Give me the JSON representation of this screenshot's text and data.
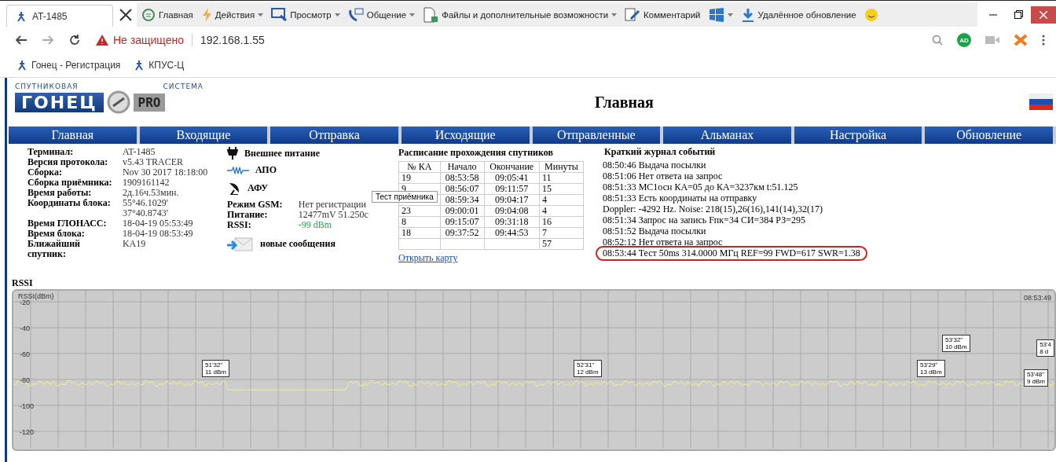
{
  "browser": {
    "tab_title": "AT-1485",
    "toolbar": [
      {
        "kind": "home",
        "label": "Главная",
        "dropdown": false
      },
      {
        "kind": "bolt",
        "label": "Действия",
        "dropdown": true
      },
      {
        "kind": "monitor",
        "label": "Просмотр",
        "dropdown": true
      },
      {
        "kind": "chat",
        "label": "Общение",
        "dropdown": true
      },
      {
        "kind": "files",
        "label": "Файлы и дополнительные возможности",
        "dropdown": true
      },
      {
        "kind": "note",
        "label": "Комментарий",
        "dropdown": false
      },
      {
        "kind": "windows",
        "dropdown": true
      },
      {
        "kind": "download",
        "label": "Удалённое обновление",
        "dropdown": false
      }
    ],
    "address": {
      "security": "Не защищено",
      "url": "192.168.1.55"
    },
    "extension_badge": "AD",
    "bookmarks": [
      "Гонец - Регистрация",
      "КПУС-Ц"
    ]
  },
  "page": {
    "logo": {
      "top_left": "СПУТНИКОВАЯ",
      "top_right": "СИСТЕМА",
      "name": "ГОНЕЦ",
      "suffix": "PRO"
    },
    "title": "Главная",
    "nav": [
      "Главная",
      "Входящие",
      "Отправка",
      "Исходящие",
      "Отправленные",
      "Альманах",
      "Настройка",
      "Обновление"
    ],
    "terminal": [
      {
        "label": "Терминал:",
        "value": "AT-1485"
      },
      {
        "label": "Версия протокола:",
        "value": "v5.43 TRACER"
      },
      {
        "label": "Сборка:",
        "value": "Nov 30 2017 18:18:00"
      },
      {
        "label": "Сборка приёмника:",
        "value": "1909161142"
      },
      {
        "label": "Время работы:",
        "value": "2д.16ч.53мин."
      },
      {
        "label": "Координаты блока:",
        "value": "55°46.1029' 37°40.8743'"
      },
      {
        "label": "Время ГЛОНАСС:",
        "value": "18-04-19 05:53:49"
      },
      {
        "label": "Время блока:",
        "value": "18-04-19 08:53:49"
      },
      {
        "label": "Ближайший спутник:",
        "value": "KA19"
      }
    ],
    "status": [
      {
        "kind": "plug",
        "label": "Внешнее питание"
      },
      {
        "kind": "wave",
        "label": "АПО"
      },
      {
        "kind": "dish",
        "label": "АФУ"
      }
    ],
    "gsm": [
      {
        "label": "Режим GSM:",
        "value": "Нет регистрации",
        "good": false
      },
      {
        "label": "Питание:",
        "value": "12477mV 51.250c",
        "good": false
      },
      {
        "label": "RSSI:",
        "value": "-99 dBm",
        "good": true
      }
    ],
    "messages": "новые сообщения",
    "tooltip": "Тест приёмника",
    "schedule": {
      "title": "Расписание прохождения спутников",
      "columns": [
        "№ КА",
        "Начало",
        "Окончание",
        "Минуты"
      ],
      "rows": [
        [
          "19",
          "08:53:58",
          "09:05:41",
          "11"
        ],
        [
          "9",
          "08:56:07",
          "09:11:57",
          "15"
        ],
        [
          "",
          "08:59:34",
          "09:04:17",
          "4"
        ],
        [
          "23",
          "09:00:01",
          "09:04:08",
          "4"
        ],
        [
          "8",
          "09:15:07",
          "09:31:18",
          "16"
        ],
        [
          "18",
          "09:37:52",
          "09:44:53",
          "7"
        ],
        [
          "",
          "",
          "",
          "57"
        ]
      ],
      "link": "Открыть карту"
    },
    "journal": {
      "title": "Краткий журнал событий",
      "entries": [
        {
          "text": "08:50:46 Выдача посылки",
          "highlighted": false
        },
        {
          "text": "08:51:06 Нет ответа на запрос",
          "highlighted": false
        },
        {
          "text": "08:51:33 МС1осн КА=05 до КА=3237км t:51.125",
          "highlighted": false
        },
        {
          "text": "08:51:33 Есть координаты на отправку",
          "highlighted": false
        },
        {
          "text": "Doppler: -4292 Hz. Noise: 218(15),26(16),141(14),32(17)",
          "highlighted": false
        },
        {
          "text": "08:51:34 Запрос на запись Fпк=34 СИ=384 РЗ=295",
          "highlighted": false
        },
        {
          "text": "08:51:52 Выдача посылки",
          "highlighted": false
        },
        {
          "text": "08:52:12 Нет ответа на запрос",
          "highlighted": false
        },
        {
          "text": "08:53:44 Тест 50ms 314.0000 МГц REF=99 FWD=617 SWR=1.38",
          "highlighted": true
        }
      ]
    },
    "rssi": {
      "label": "RSSI",
      "axis_title": "RSSI(dBm)",
      "yticks": [
        "-20",
        "-40",
        "-60",
        "-80",
        "-100",
        "-120"
      ],
      "time": "08:53:49",
      "callouts": [
        {
          "time": "51'32\"",
          "value": "11 dBm"
        },
        {
          "time": "52'31\"",
          "value": "12 dBm"
        },
        {
          "time": "53'29\"",
          "value": "13 dBm"
        },
        {
          "time": "53'32\"",
          "value": "10 dBm"
        },
        {
          "time": "53'48\"",
          "value": "9 dBm"
        },
        {
          "time": "53'4",
          "value": "8 d"
        }
      ]
    }
  }
}
